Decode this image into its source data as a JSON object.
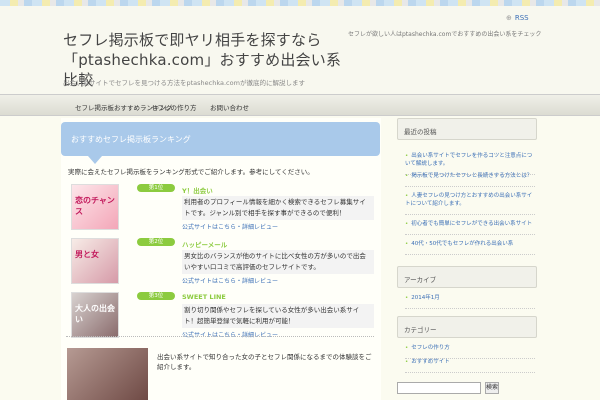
{
  "header": {
    "site_title": "セフレ掲示板で即ヤリ相手を探すなら",
    "site_title_2": "「ptashechka.com」おすすめ出会い系比較",
    "site_desc": "出会い系サイトでセフレを見つける方法をptashechka.comが徹底的に解説します",
    "header_note": "セフレが欲しい人はptashechka.comでおすすめの出会い系をチェック",
    "rss": "RSS"
  },
  "nav": [
    "セフレ掲示板おすすめランキング",
    "セフレの作り方",
    "お問い合わせ"
  ],
  "main": {
    "banner_title": "おすすめセフレ掲示板ランキング",
    "intro": "実際に会えたセフレ掲示板をランキング形式でご紹介します。参考にしてください。",
    "cards": [
      {
        "rank": "第1位",
        "name": "Y！出会い",
        "thumb": "恋のチャンス",
        "desc": "利用者のプロフィール情報を細かく検索できるセフレ募集サイトです。ジャンル別で相手を探す事ができるので便利！",
        "link": "公式サイトはこちら・詳細レビュー"
      },
      {
        "rank": "第2位",
        "name": "ハッピーメール",
        "thumb": "男と女",
        "desc": "男女比のバランスが他のサイトに比べ女性の方が多いので出会いやすい口コミで高評価のセフレサイトです。",
        "link": "公式サイトはこちら・詳細レビュー"
      },
      {
        "rank": "第3位",
        "name": "SWEET LINE",
        "thumb": "大人の出会い",
        "desc": "割り切り関係やセフレを探している女性が多い出会い系サイト！超簡単登録で気軽に利用が可能！",
        "link": "公式サイトはこちら・詳細レビュー"
      }
    ],
    "bottom_text": "出会い系サイトで知り合った女の子とセフレ関係になるまでの体験談をご紹介します。"
  },
  "sidebar": {
    "recent_head": "最近の投稿",
    "recent_items": [
      "出会い系サイトでセフレを作るコツと注意点について解説します。",
      "掲示板で見つけたセフレと長続きする方法とは？",
      "人妻セフレの見つけ方とおすすめの出会い系サイトについて紹介します。",
      "初心者でも簡単にセフレができる出会い系サイト",
      "40代・50代でもセフレが作れる出会い系"
    ],
    "archive_head": "アーカイブ",
    "archive_items": [
      "2014年1月"
    ],
    "category_head": "カテゴリー",
    "category_items": [
      "セフレの作り方",
      "おすすめサイト"
    ],
    "search_button": "検索"
  }
}
